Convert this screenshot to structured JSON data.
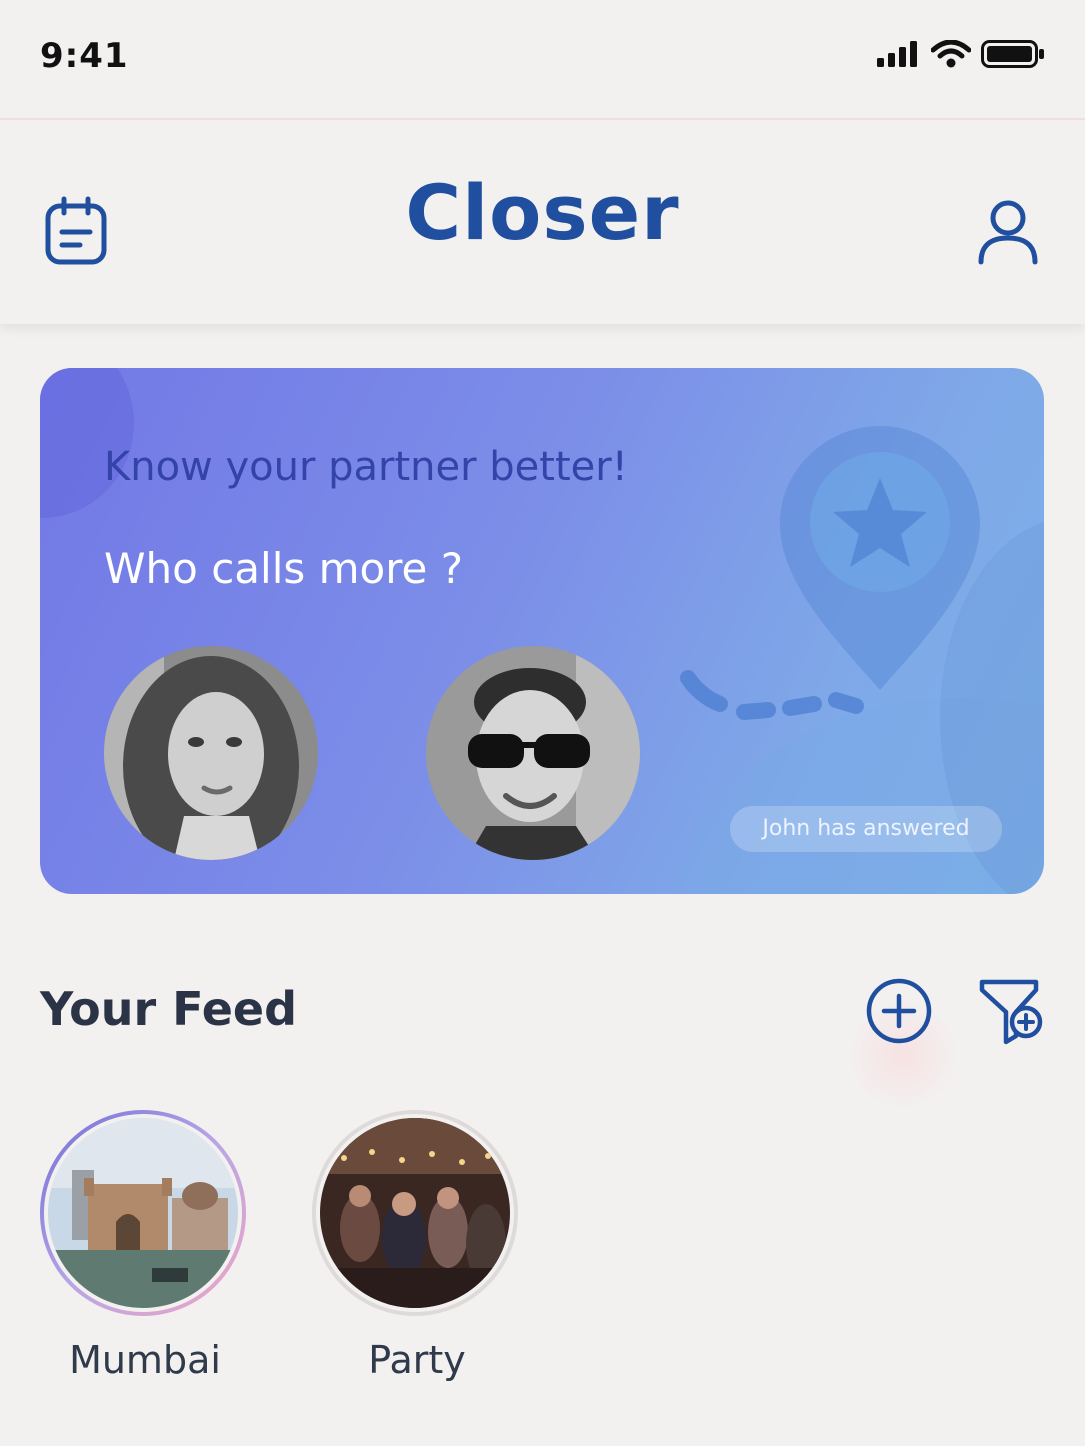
{
  "status_bar": {
    "time": "9:41"
  },
  "header": {
    "title": "Closer"
  },
  "quiz_card": {
    "eyebrow": "Know your partner better!",
    "question": "Who calls more ?",
    "answer_badge": "John has answered"
  },
  "feed": {
    "title": "Your Feed",
    "stories": [
      {
        "label": "Mumbai"
      },
      {
        "label": "Party"
      }
    ]
  },
  "colors": {
    "brand": "#1f4f9e",
    "background": "#f3f0f0",
    "card_gradient_start": "#7278e6",
    "card_gradient_end": "#7cb2e8"
  }
}
